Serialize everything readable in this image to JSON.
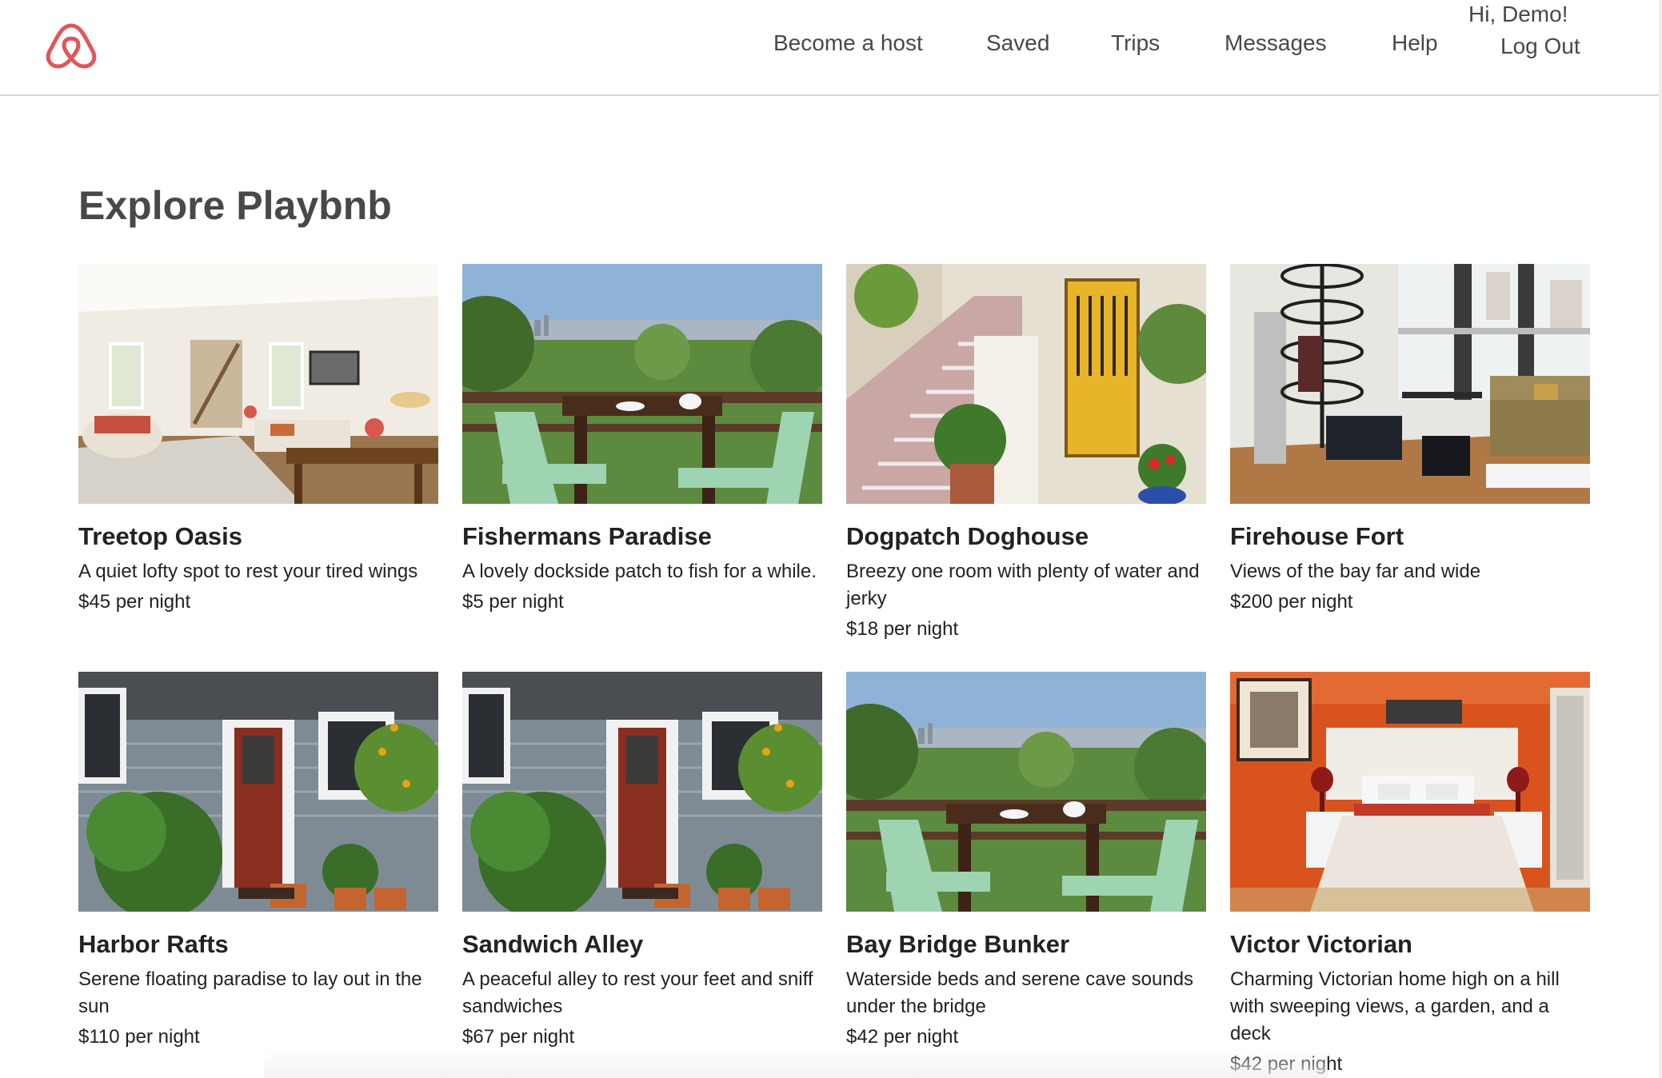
{
  "header": {
    "logo_icon": "playbnb-logo-icon",
    "brand_color": "#e0565b",
    "nav": [
      {
        "label": "Become a host"
      },
      {
        "label": "Saved"
      },
      {
        "label": "Trips"
      },
      {
        "label": "Messages"
      },
      {
        "label": "Help"
      }
    ],
    "greeting": "Hi, Demo!",
    "logout_label": "Log Out"
  },
  "main": {
    "title": "Explore Playbnb",
    "listings": [
      {
        "title": "Treetop Oasis",
        "description": "A quiet lofty spot to rest your tired wings",
        "price": "$45 per night",
        "image": "living-room"
      },
      {
        "title": "Fishermans Paradise",
        "description": "A lovely dockside patch to fish for a while.",
        "price": "$5 per night",
        "image": "patio-view"
      },
      {
        "title": "Dogpatch Doghouse",
        "description": "Breezy one room with plenty of water and jerky",
        "price": "$18 per night",
        "image": "yellow-door"
      },
      {
        "title": "Firehouse Fort",
        "description": "Views of the bay far and wide",
        "price": "$200 per night",
        "image": "loft-staircase"
      },
      {
        "title": "Harbor Rafts",
        "description": "Serene floating paradise to lay out in the sun",
        "price": "$110 per night",
        "image": "garden-house"
      },
      {
        "title": "Sandwich Alley",
        "description": "A peaceful alley to rest your feet and sniff sandwiches",
        "price": "$67 per night",
        "image": "garden-house"
      },
      {
        "title": "Bay Bridge Bunker",
        "description": "Waterside beds and serene cave sounds under the bridge",
        "price": "$42 per night",
        "image": "patio-view"
      },
      {
        "title": "Victor Victorian",
        "description": "Charming Victorian home high on a hill with sweeping views, a garden, and a deck",
        "price": "$42 per night",
        "image": "bedroom"
      }
    ]
  }
}
